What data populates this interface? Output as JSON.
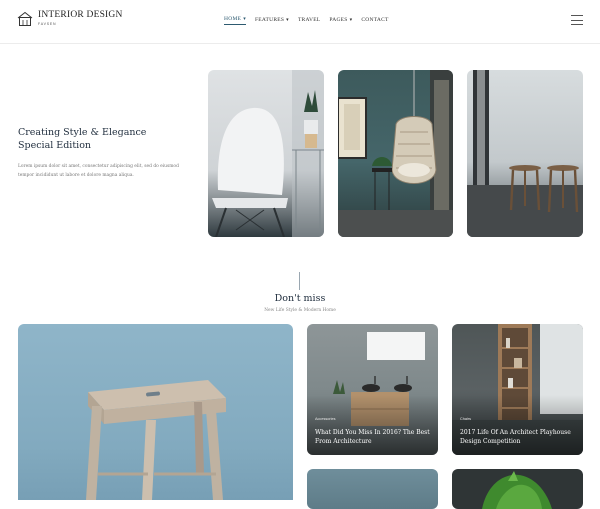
{
  "brand": {
    "title": "INTERIOR DESIGN",
    "subtitle": "FAVSEN"
  },
  "nav": {
    "items": [
      {
        "label": "HOME",
        "active": true,
        "dropdown": true
      },
      {
        "label": "FEATURES",
        "active": false,
        "dropdown": true
      },
      {
        "label": "TRAVEL",
        "active": false,
        "dropdown": false
      },
      {
        "label": "PAGES",
        "active": false,
        "dropdown": true
      },
      {
        "label": "CONTACT",
        "active": false,
        "dropdown": false
      }
    ],
    "menu_icon": "hamburger-icon"
  },
  "hero": {
    "title_line1": "Creating Style & Elegance",
    "title_line2": "Special Edition",
    "text": "Lorem ipsum dolor sit amet, consectetur adipiscing elit, sed do eiusmod tempor incididunt ut labore et dolore magna aliqua."
  },
  "section": {
    "title": "Don't miss",
    "subtitle": "New Life Style & Modern Home"
  },
  "posts": [
    {
      "category": "Accessories",
      "title": "What Did You Miss In 2016? The Best From Architecture"
    },
    {
      "category": "Chairs",
      "title": "2017 Life Of An Architect Playhouse Design Competition"
    }
  ],
  "colors": {
    "accent": "#2d5a70",
    "text": "#1f2d3d"
  }
}
